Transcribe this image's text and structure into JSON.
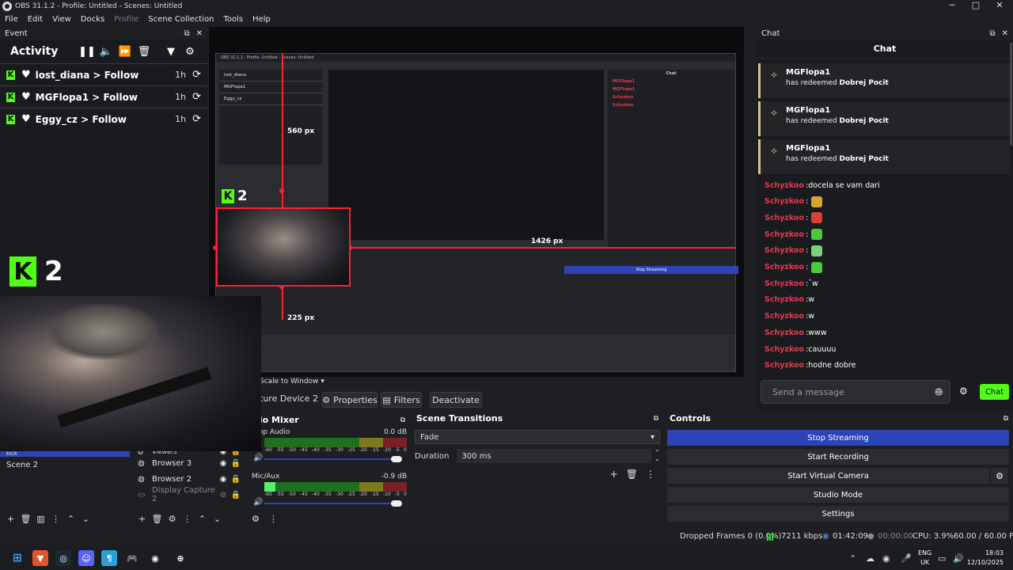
{
  "window": {
    "title": "OBS 31.1.2 - Profile: Untitled - Scenes: Untitled",
    "controls": [
      "─",
      "□",
      "✕"
    ]
  },
  "menu": [
    "File",
    "Edit",
    "View",
    "Docks",
    "Profile",
    "Scene Collection",
    "Tools",
    "Help"
  ],
  "event_dock": {
    "title": "Event",
    "activity_title": "Activity",
    "events": [
      {
        "user": "lost_diana",
        "action": "Follow",
        "time": "1h"
      },
      {
        "user": "MGFlopa1",
        "action": "Follow",
        "time": "1h"
      },
      {
        "user": "Eggy_cz",
        "action": "Follow",
        "time": "1h"
      }
    ],
    "kick_count": "2"
  },
  "preview": {
    "nested_title": "OBS 31.1.2 - Profile: Untitled - Scenes: Untitled",
    "nested_stream_label": "Stop Streaming",
    "width_label": "1426 px",
    "height_label": "560 px",
    "bottom_label": "225 px",
    "kick_count": "2"
  },
  "source_bar": {
    "scale_label": "Scale to Window",
    "source_name": "ture Device 2",
    "properties": "Properties",
    "filters": "Filters",
    "deactivate": "Deactivate"
  },
  "scenes": {
    "items": [
      "kick",
      "Scene 2"
    ]
  },
  "sources": {
    "items": [
      {
        "name": "Viewers",
        "dim": false
      },
      {
        "name": "Browser 3",
        "dim": false
      },
      {
        "name": "Browser 2",
        "dim": false
      },
      {
        "name": "Display Capture 2",
        "dim": true
      }
    ]
  },
  "mixer": {
    "title": "dio Mixer",
    "channels": [
      {
        "name": "ktop Audio",
        "db": "0.0 dB"
      },
      {
        "name": "Mic/Aux",
        "db": "-0.9 dB"
      }
    ],
    "scale": [
      "-60",
      "-55",
      "-50",
      "-45",
      "-40",
      "-35",
      "-30",
      "-25",
      "-20",
      "-15",
      "-10",
      "-5",
      "0"
    ]
  },
  "transitions": {
    "title": "Scene Transitions",
    "selected": "Fade",
    "duration_label": "Duration",
    "duration_value": "300 ms"
  },
  "controls": {
    "title": "Controls",
    "buttons": [
      "Stop Streaming",
      "Start Recording",
      "Start Virtual Camera",
      "Studio Mode",
      "Settings"
    ]
  },
  "status": {
    "dropped": "Dropped Frames 0 (0.0%)",
    "bitrate": "7211 kbps",
    "stream_time": "01:42:09",
    "rec_time": "00:00:00",
    "cpu": "CPU: 3.9%",
    "fps": "60.00 / 60.00 FPS"
  },
  "chat": {
    "dock_title": "Chat",
    "title": "Chat",
    "redeems": [
      {
        "user": "MGFlopa1",
        "text": "has redeemed",
        "reward": "Dobrej Pocit"
      },
      {
        "user": "MGFlopa1",
        "text": "has redeemed",
        "reward": "Dobrej Pocit"
      },
      {
        "user": "MGFlopa1",
        "text": "has redeemed",
        "reward": "Dobrej Pocit"
      }
    ],
    "messages": [
      {
        "user": "Schyzkoo",
        "text": "docela se vam dari",
        "emote": ""
      },
      {
        "user": "Schyzkoo",
        "text": "",
        "emote": "#d9a531"
      },
      {
        "user": "Schyzkoo",
        "text": "",
        "emote": "#d9403a"
      },
      {
        "user": "Schyzkoo",
        "text": "",
        "emote": "#49c83a"
      },
      {
        "user": "Schyzkoo",
        "text": "",
        "emote": "#7fd07a"
      },
      {
        "user": "Schyzkoo",
        "text": "",
        "emote": "#49c83a"
      },
      {
        "user": "Schyzkoo",
        "text": "¯w",
        "emote": ""
      },
      {
        "user": "Schyzkoo",
        "text": "w",
        "emote": ""
      },
      {
        "user": "Schyzkoo",
        "text": "w",
        "emote": ""
      },
      {
        "user": "Schyzkoo",
        "text": "www",
        "emote": ""
      },
      {
        "user": "Schyzkoo",
        "text": "cauuuu",
        "emote": ""
      },
      {
        "user": "Schyzkoo",
        "text": "hodne dobre",
        "emote": ""
      }
    ],
    "input_placeholder": "Send a message",
    "send_label": "Chat"
  },
  "taskbar": {
    "lang_line1": "ENG",
    "lang_line2": "UK",
    "time": "18:03",
    "date": "12/10/2025"
  },
  "colors": {
    "accent_blue": "#2c44b8",
    "kick_green": "#53fc18",
    "red_guide": "#ff2030",
    "chat_user": "#e6394f"
  }
}
